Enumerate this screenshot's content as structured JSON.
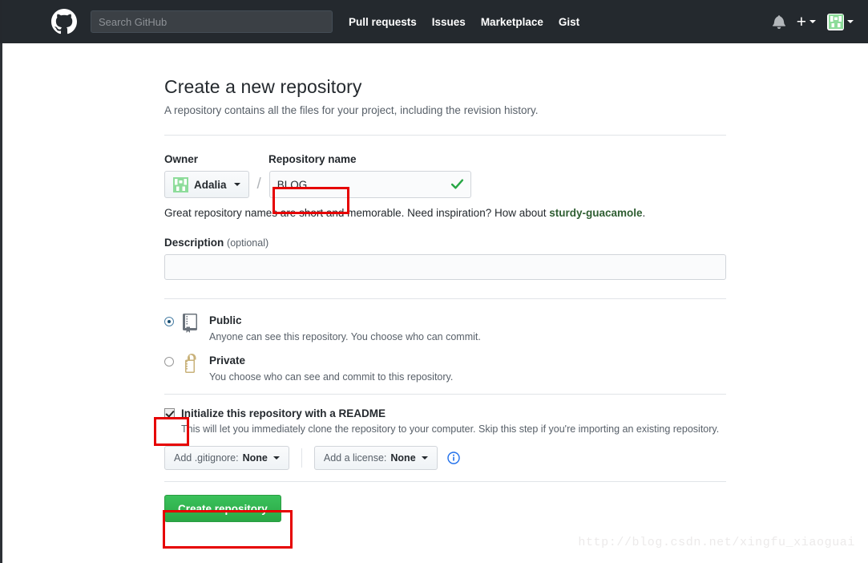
{
  "header": {
    "logo_icon": "github-mark-icon",
    "search": {
      "placeholder": "Search GitHub",
      "value": ""
    },
    "nav": [
      {
        "label": "Pull requests"
      },
      {
        "label": "Issues"
      },
      {
        "label": "Marketplace"
      },
      {
        "label": "Gist"
      }
    ],
    "notifications_icon": "bell-icon",
    "create_new_label": "+",
    "create_new_icon": "plus-icon",
    "account_icon": "user-avatar-icon",
    "background_color": "#24292e"
  },
  "page": {
    "title": "Create a new repository",
    "subtitle": "A repository contains all the files for your project, including the revision history."
  },
  "form": {
    "owner_label": "Owner",
    "owner_value": "Adalia",
    "owner_avatar_icon": "identicon-avatar-icon",
    "separator": "/",
    "repo_name_label": "Repository name",
    "repo_name_value": "BLOG",
    "repo_name_placeholder": "",
    "name_valid_icon": "check-mark-icon",
    "name_hint_prefix": "Great repository names are short and memorable. Need inspiration? How about ",
    "name_hint_suggestion": "sturdy-guacamole",
    "name_hint_suffix": ".",
    "description_label": "Description",
    "description_optional": "(optional)",
    "description_value": "",
    "description_placeholder": "",
    "visibility": [
      {
        "name": "Public",
        "description": "Anyone can see this repository. You choose who can commit.",
        "selected": true,
        "icon": "repo-book-icon"
      },
      {
        "name": "Private",
        "description": "You choose who can see and commit to this repository.",
        "selected": false,
        "icon": "lock-icon"
      }
    ],
    "readme_label": "Initialize this repository with a README",
    "readme_description": "This will let you immediately clone the repository to your computer. Skip this step if you're importing an existing repository.",
    "readme_checked": true,
    "gitignore_prefix": "Add .gitignore:",
    "gitignore_value": "None",
    "license_prefix": "Add a license:",
    "license_value": "None",
    "info_icon": "info-circle-icon",
    "submit_label": "Create repository"
  },
  "annotations": {
    "color": "#e60000",
    "boxes": [
      {
        "target": "repo-name-input"
      },
      {
        "target": "readme-checkbox"
      },
      {
        "target": "create-repository-button"
      }
    ]
  },
  "watermark": "http://blog.csdn.net/xingfu_xiaoguai",
  "colors": {
    "header_bg": "#24292e",
    "submit_green": "#2aa745",
    "suggestion_green": "#2f5e32",
    "check_green": "#28a745",
    "lock_gold": "#c9b27a",
    "info_blue": "#1f6feb"
  }
}
